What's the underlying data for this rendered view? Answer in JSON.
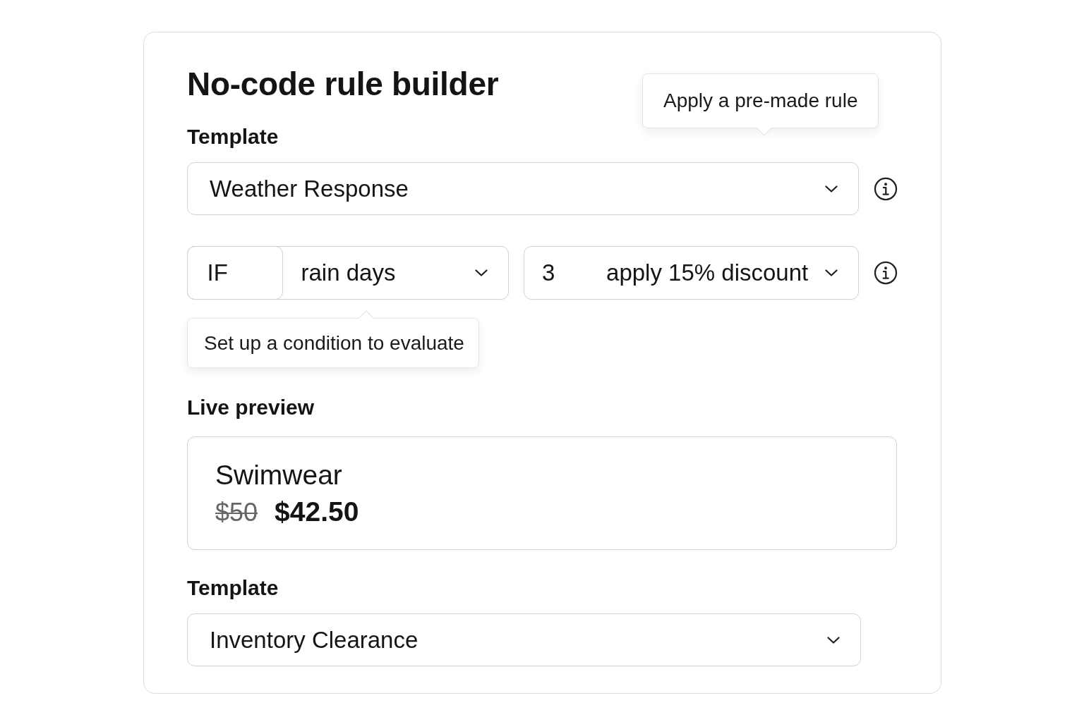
{
  "title": "No-code rule builder",
  "template": {
    "label": "Template",
    "value": "Weather Response",
    "tooltip": "Apply a pre-made rule"
  },
  "condition": {
    "keyword": "IF",
    "field": "rain days",
    "threshold": "3",
    "action": "apply 15% discount",
    "tooltip": "Set up a condition to evaluate"
  },
  "live_preview": {
    "label": "Live preview",
    "product": "Swimwear",
    "original_price": "$50",
    "price": "$42.50"
  },
  "bottom_template": {
    "label": "Template",
    "value": "Inventory Clearance"
  }
}
